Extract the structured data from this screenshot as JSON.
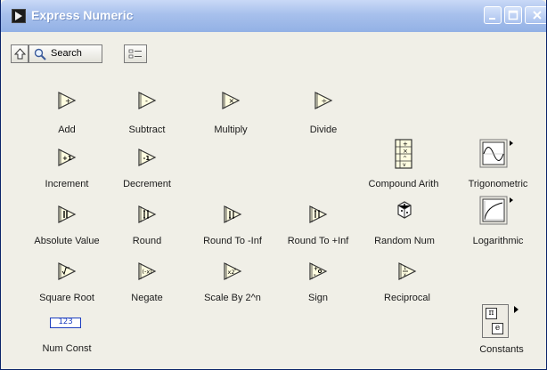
{
  "window": {
    "title": "Express Numeric"
  },
  "toolbar": {
    "search_label": "Search"
  },
  "palette": {
    "items": [
      {
        "label": "Add",
        "icon": "add-icon"
      },
      {
        "label": "Subtract",
        "icon": "subtract-icon"
      },
      {
        "label": "Multiply",
        "icon": "multiply-icon"
      },
      {
        "label": "Divide",
        "icon": "divide-icon"
      },
      {
        "label": "Increment",
        "icon": "increment-icon"
      },
      {
        "label": "Decrement",
        "icon": "decrement-icon"
      },
      {
        "label": "Compound Arith",
        "icon": "compound-arith-icon"
      },
      {
        "label": "Trigonometric",
        "icon": "trigonometric-icon"
      },
      {
        "label": "Absolute Value",
        "icon": "absolute-value-icon"
      },
      {
        "label": "Round",
        "icon": "round-icon"
      },
      {
        "label": "Round To -Inf",
        "icon": "round-to-neg-inf-icon"
      },
      {
        "label": "Round To +Inf",
        "icon": "round-to-pos-inf-icon"
      },
      {
        "label": "Random Num",
        "icon": "random-num-icon"
      },
      {
        "label": "Logarithmic",
        "icon": "logarithmic-icon"
      },
      {
        "label": "Square Root",
        "icon": "square-root-icon"
      },
      {
        "label": "Negate",
        "icon": "negate-icon"
      },
      {
        "label": "Scale By 2^n",
        "icon": "scale-by-2n-icon"
      },
      {
        "label": "Sign",
        "icon": "sign-icon"
      },
      {
        "label": "Reciprocal",
        "icon": "reciprocal-icon"
      },
      {
        "label": "Num Const",
        "icon": "num-const-icon",
        "value": "123"
      },
      {
        "label": "Constants",
        "icon": "constants-icon",
        "glyphs": [
          "π",
          "e"
        ]
      }
    ]
  },
  "colors": {
    "title_bar": "#a7c0ec",
    "body": "#f0efe7",
    "icon_fill": "#fffde0",
    "num_const_border": "#1e3fbf"
  }
}
